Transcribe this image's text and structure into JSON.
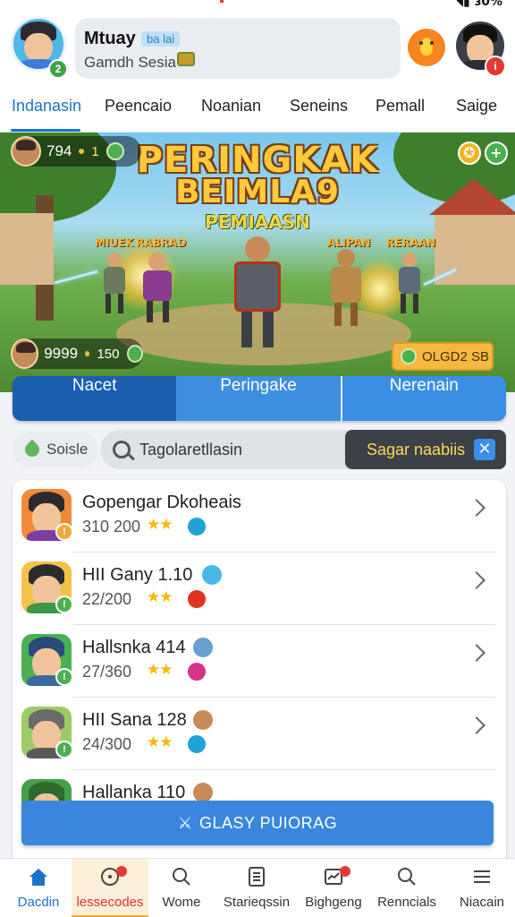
{
  "status": {
    "signal": "◥▮ ɜ0%"
  },
  "header": {
    "username": "Mtuay",
    "tag": "ba lai",
    "subtitle": "Gamdh Sesia",
    "level_badge": "2",
    "alert_badge": "i"
  },
  "tabs": [
    "Indanasin",
    "Peencaio",
    "Noanian",
    "Seneins",
    "Pemall",
    "Saige"
  ],
  "banner": {
    "title_line1": "PERINGKAK",
    "title_line2": "BEIMLA9",
    "subtitle": "PEMIAASN",
    "fighter_labels": [
      "MIUEK",
      "RABRAD",
      "ALIPAN",
      "RERAAN"
    ],
    "top_pill": {
      "score": "794",
      "count": "1"
    },
    "bottom_pill": {
      "score": "9999",
      "count": "150"
    },
    "reward_label": "OLGD2 SB"
  },
  "segments": [
    "Nacet",
    "Peringake",
    "Nerenain"
  ],
  "filter": {
    "chip_label": "Soisle",
    "search_placeholder": "Tagolaretllasin",
    "sugar_label": "Sagar naabiis"
  },
  "leaderboard": [
    {
      "name": "Gopengar Dkoheais",
      "score": "310 200",
      "stars": "★★",
      "badge": "!"
    },
    {
      "name": "HII Gany 1.10",
      "score": "22/200",
      "stars": "★★",
      "badge": "!"
    },
    {
      "name": "Hallsnka 414",
      "score": "27/360",
      "stars": "★★",
      "badge": "!"
    },
    {
      "name": "HII Sana 128",
      "score": "24/300",
      "stars": "★★",
      "badge": "!"
    },
    {
      "name": "Hallanka 110",
      "score": "",
      "stars": "",
      "badge": ""
    }
  ],
  "cta": {
    "label": "GLASY PUIORAG",
    "icon": "⚔"
  },
  "bottom_nav": [
    "Dacdin",
    "lessecodes",
    "Wome",
    "Starieqssin",
    "Bighgeng",
    "Renncials",
    "Niacain"
  ],
  "colors": {
    "primary": "#1a73c7",
    "accent": "#f5b840",
    "alert": "#e53935"
  }
}
